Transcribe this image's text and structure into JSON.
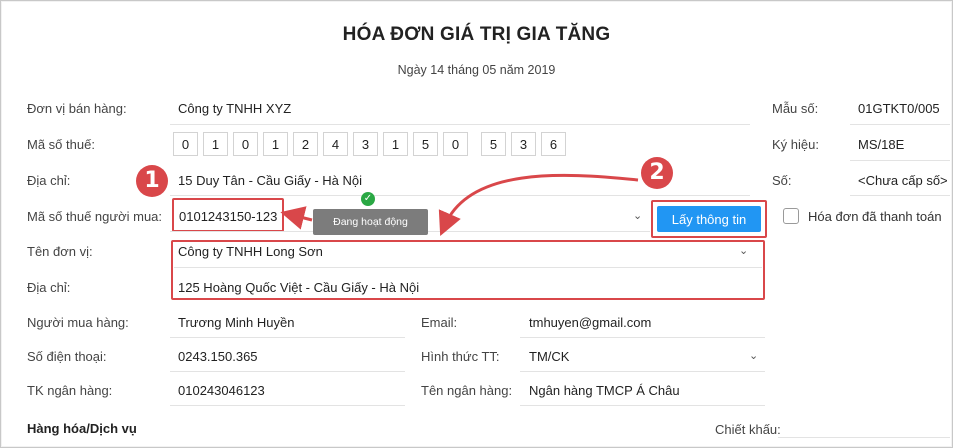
{
  "invoice": {
    "title": "HÓA ĐƠN GIÁ TRỊ GIA TĂNG",
    "date": "Ngày 14 tháng 05 năm 2019"
  },
  "seller": {
    "name_label": "Đơn vị bán hàng:",
    "name_value": "Công ty TNHH XYZ",
    "tax_label": "Mã số thuế:",
    "tax_digits": [
      "0",
      "1",
      "0",
      "1",
      "2",
      "4",
      "3",
      "1",
      "5",
      "0",
      "5",
      "3",
      "6"
    ],
    "address_label": "Địa chỉ:",
    "address_value": "15 Duy Tân - Cầu Giấy - Hà Nội"
  },
  "meta": {
    "form_label": "Mẫu số:",
    "form_value": "01GTKT0/005",
    "symbol_label": "Ký hiệu:",
    "symbol_value": "MS/18E",
    "number_label": "Số:",
    "number_value": "<Chưa cấp số>"
  },
  "buyer": {
    "tax_label": "Mã số thuế người mua:",
    "tax_value": "0101243150-123",
    "status_tooltip": "Đang hoạt động",
    "fetch_button": "Lấy thông tin",
    "paid_checkbox_label": "Hóa đơn đã thanh toán",
    "unit_label": "Tên đơn vị:",
    "unit_value": "Công ty TNHH Long Sơn",
    "address_label": "Địa chỉ:",
    "address_value": "125 Hoàng Quốc Việt - Cầu Giấy - Hà Nội",
    "person_label": "Người mua hàng:",
    "person_value": "Trương Minh Huyền",
    "email_label": "Email:",
    "email_value": "tmhuyen@gmail.com",
    "phone_label": "Số điện thoại:",
    "phone_value": "0243.150.365",
    "payment_label": "Hình thức TT:",
    "payment_value": "TM/CK",
    "bank_account_label": "TK ngân hàng:",
    "bank_account_value": "010243046123",
    "bank_name_label": "Tên ngân hàng:",
    "bank_name_value": "Ngân hàng TMCP Á Châu"
  },
  "footer": {
    "goods_label": "Hàng hóa/Dịch vụ",
    "discount_label": "Chiết khấu:"
  },
  "annotations": {
    "step1": "1",
    "step2": "2",
    "highlight_color": "#d9474a",
    "button_color": "#2196f3"
  }
}
